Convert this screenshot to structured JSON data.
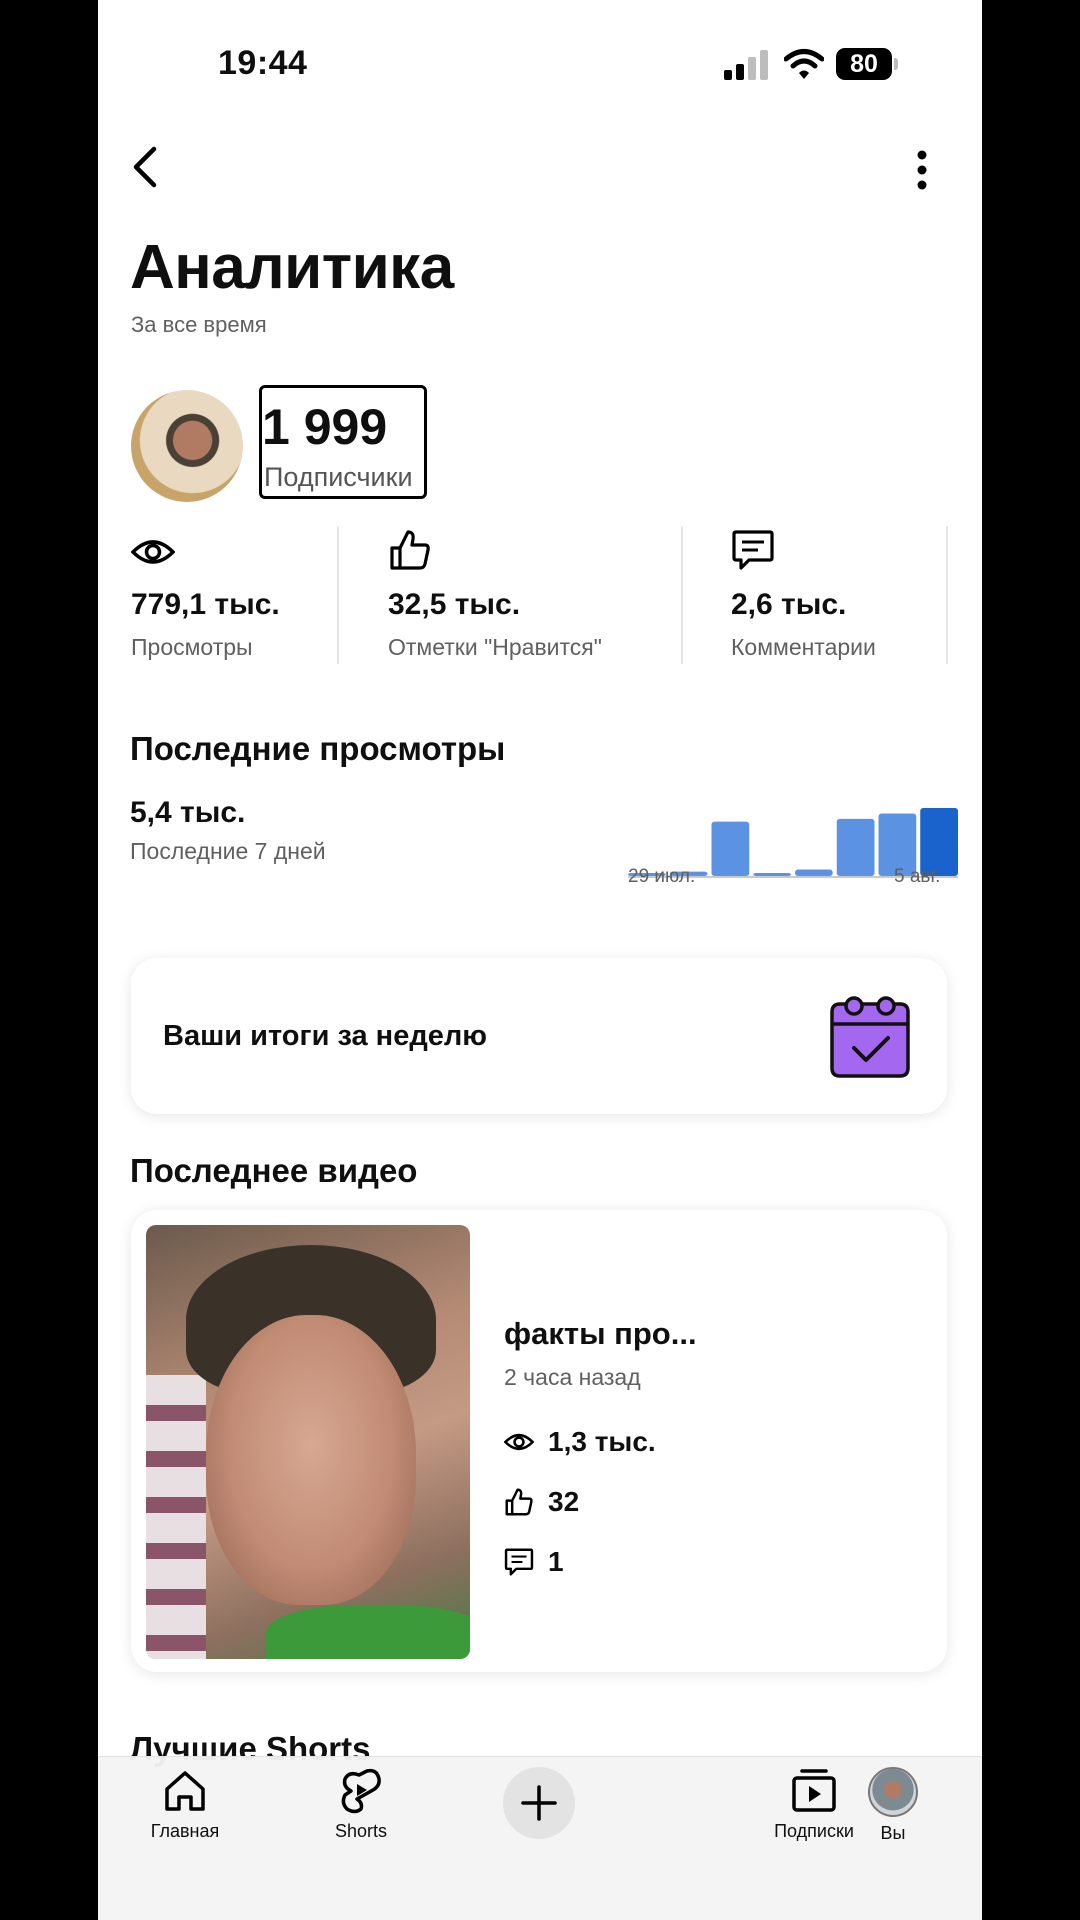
{
  "status_bar": {
    "time": "19:44",
    "battery": "80"
  },
  "header": {
    "title": "Аналитика",
    "subtitle": "За все время"
  },
  "channel": {
    "subscribers_value": "1 999",
    "subscribers_label": "Подписчики"
  },
  "stats": [
    {
      "icon": "eye-icon",
      "value": "779,1 тыс.",
      "label": "Просмотры"
    },
    {
      "icon": "thumbs-up-icon",
      "value": "32,5 тыс.",
      "label": "Отметки \"Нравится\""
    },
    {
      "icon": "comment-icon",
      "value": "2,6 тыс.",
      "label": "Комментарии"
    }
  ],
  "last_views": {
    "title": "Последние просмотры",
    "value": "5,4 тыс.",
    "period": "Последние 7 дней",
    "chart_start_label": "29 июл.",
    "chart_end_label": "5 авг."
  },
  "chart_data": {
    "type": "bar",
    "bar_count": 8,
    "values": [
      0.05,
      0.08,
      1.0,
      0.05,
      0.12,
      1.05,
      1.15,
      1.25
    ],
    "x_labels": [
      "29 июл.",
      "5 авг."
    ],
    "colors": {
      "bar": "#5b93e2",
      "last_bar": "#1a63cc",
      "baseline": "#c9c9c9"
    }
  },
  "weekly_summary": {
    "label": "Ваши итоги за неделю"
  },
  "last_video": {
    "section_title": "Последнее видео",
    "title": "факты про...",
    "time": "2 часа назад",
    "views": "1,3 тыс.",
    "likes": "32",
    "comments": "1"
  },
  "best_shorts": {
    "section_title": "Лучшие Shorts"
  },
  "nav": {
    "home": "Главная",
    "shorts": "Shorts",
    "subscriptions": "Подписки",
    "you": "Вы"
  },
  "colors": {
    "accent_purple": "#a367f0",
    "chart_blue": "#5b93e2"
  }
}
